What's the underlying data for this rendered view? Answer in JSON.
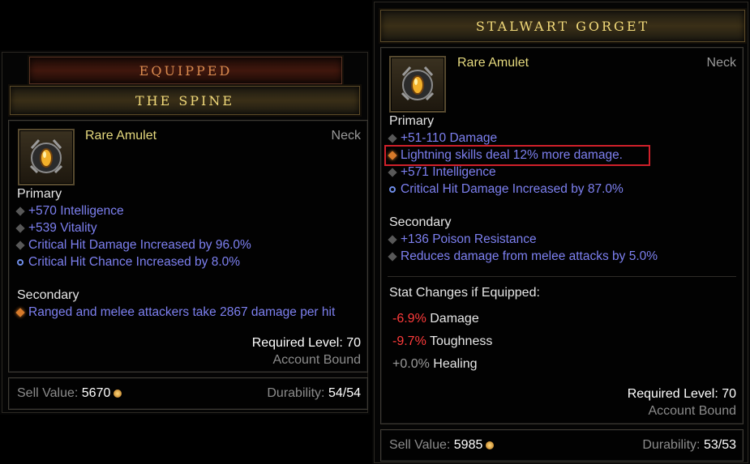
{
  "left": {
    "header": "EQUIPPED",
    "item_name": "THE SPINE",
    "item_type": "Rare Amulet",
    "slot": "Neck",
    "primary_label": "Primary",
    "primary": [
      {
        "text": "+570 Intelligence",
        "bullet": "grey"
      },
      {
        "text": "+539 Vitality",
        "bullet": "grey"
      },
      {
        "text": "Critical Hit Damage Increased by 96.0%",
        "bullet": "grey"
      },
      {
        "text": "Critical Hit Chance Increased by 8.0%",
        "bullet": "ring"
      }
    ],
    "secondary_label": "Secondary",
    "secondary": [
      {
        "text": "Ranged and melee attackers take 2867 damage per hit",
        "bullet": "orange"
      }
    ],
    "required_level": "Required Level: 70",
    "bound": "Account Bound",
    "sell_label": "Sell Value:",
    "sell_value": "5670",
    "durability_label": "Durability:",
    "durability_value": "54/54"
  },
  "right": {
    "item_name": "STALWART GORGET",
    "item_type": "Rare Amulet",
    "slot": "Neck",
    "primary_label": "Primary",
    "primary": [
      {
        "text": "+51-110 Damage",
        "bullet": "grey"
      },
      {
        "text": "Lightning skills deal 12% more damage.",
        "bullet": "orange"
      },
      {
        "text": "+571 Intelligence",
        "bullet": "grey"
      },
      {
        "text": "Critical Hit Damage Increased by 87.0%",
        "bullet": "ring"
      }
    ],
    "secondary_label": "Secondary",
    "secondary": [
      {
        "text": "+136 Poison Resistance",
        "bullet": "grey"
      },
      {
        "text": "Reduces damage from melee attacks by 5.0%",
        "bullet": "grey"
      }
    ],
    "stat_changes_label": "Stat Changes if Equipped:",
    "stat_changes": [
      {
        "delta": "-6.9%",
        "label": "Damage"
      },
      {
        "delta": "-9.7%",
        "label": "Toughness"
      },
      {
        "delta": "+0.0%",
        "label": "Healing"
      }
    ],
    "required_level": "Required Level: 70",
    "bound": "Account Bound",
    "sell_label": "Sell Value:",
    "sell_value": "5985",
    "durability_label": "Durability:",
    "durability_value": "53/53"
  },
  "colors": {
    "magic_text": "#7d80f0",
    "rare_text": "#e5d97e",
    "negative": "#ff3b3b",
    "highlight": "#d0202a"
  },
  "icons": {
    "amulet": "amulet-icon",
    "coin": "gold-coin-icon"
  }
}
